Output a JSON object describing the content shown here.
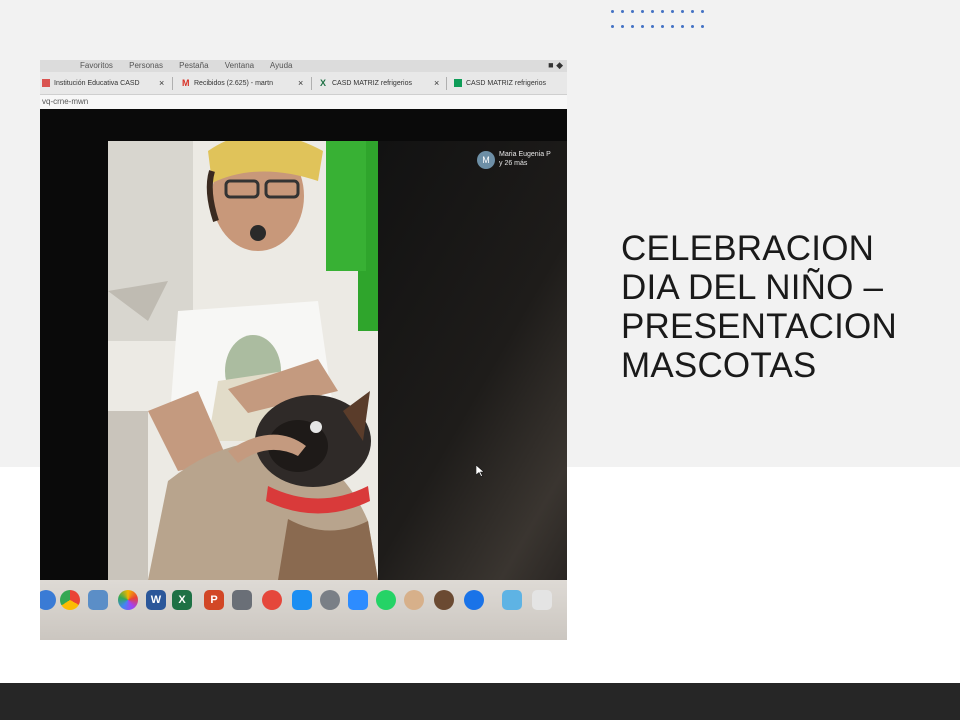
{
  "slide": {
    "title_lines": [
      "CELEBRACION",
      "DIA DEL NIÑO –",
      "PRESENTACION",
      "MASCOTAS"
    ],
    "accent_color": "#4472c4",
    "top_band_color": "#f2f2f2",
    "bottom_bar_color": "#262626"
  },
  "screen_photo": {
    "menu_items": [
      "Favoritos",
      "Personas",
      "Pestaña",
      "Ventana",
      "Ayuda"
    ],
    "tabs": [
      {
        "icon": "institution-favicon-icon",
        "label": "Institución Educativa CASD"
      },
      {
        "icon": "gmail-icon",
        "label": "Recibidos (2.625) - martn"
      },
      {
        "icon": "excel-icon",
        "label": "CASD MATRIZ refrigerios"
      },
      {
        "icon": "sheets-icon",
        "label": "CASD MATRIZ refrigerios"
      }
    ],
    "url_text": "vq-crne-mwn",
    "participant": {
      "initial": "M",
      "name": "Maria Eugenia P",
      "more": "y 26 más"
    }
  }
}
